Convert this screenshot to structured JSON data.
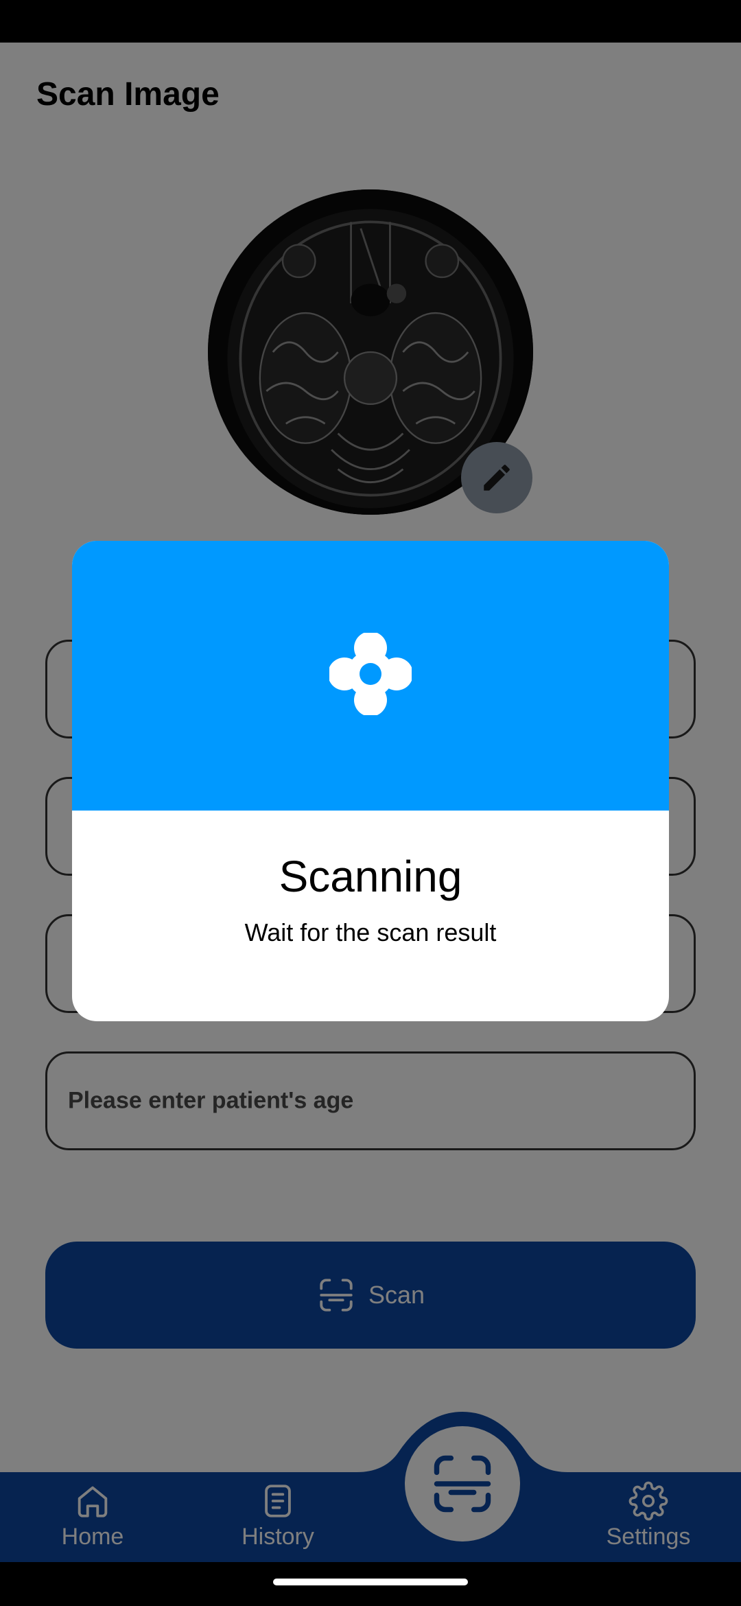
{
  "page": {
    "title": "Scan Image"
  },
  "form": {
    "fields": [
      {
        "placeholder": ""
      },
      {
        "placeholder": ""
      },
      {
        "placeholder": ""
      },
      {
        "placeholder": "Please enter patient's age"
      }
    ],
    "scan_button_label": "Scan"
  },
  "bottom_nav": {
    "items": [
      {
        "label": "Home",
        "icon": "home-icon"
      },
      {
        "label": "History",
        "icon": "history-icon"
      },
      {
        "label": "Settings",
        "icon": "settings-icon"
      }
    ],
    "center_action_icon": "scan-icon"
  },
  "dialog": {
    "title": "Scanning",
    "message": "Wait for the scan result",
    "header_color": "#0099ff"
  },
  "colors": {
    "primary": "#0d47a1",
    "accent": "#0099ff"
  }
}
